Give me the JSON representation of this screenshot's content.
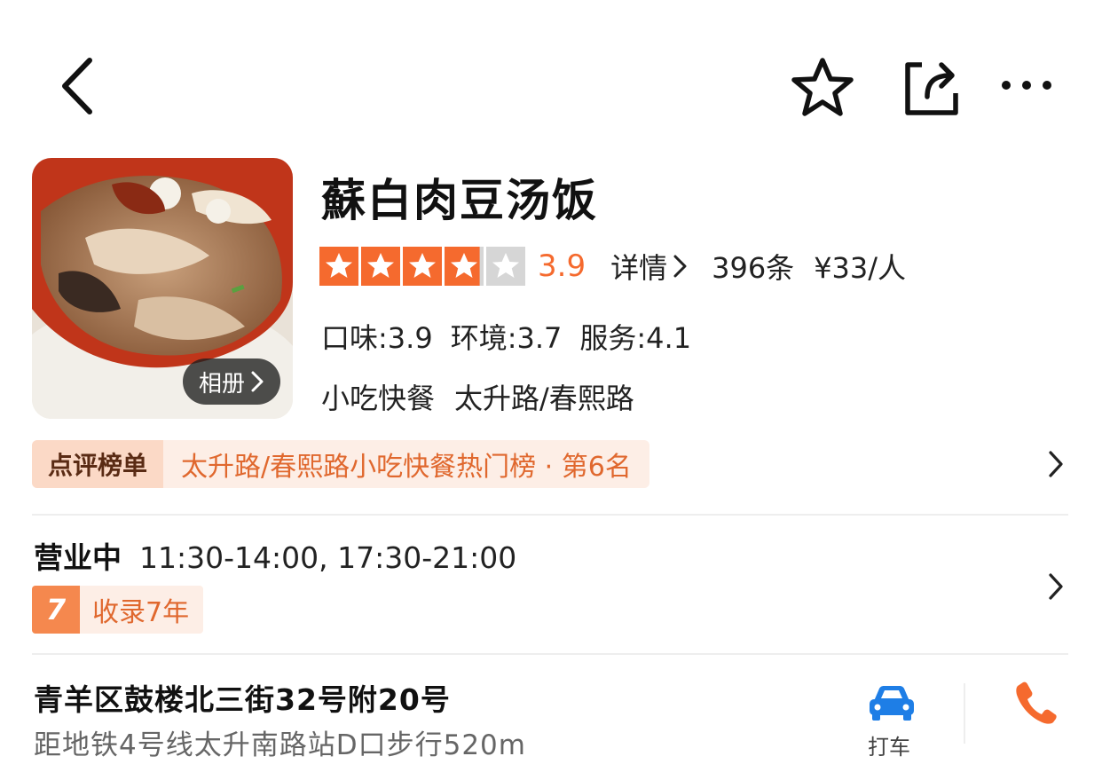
{
  "nav": {
    "back_icon": "chevron-left-icon",
    "favorite_icon": "star-outline-icon",
    "share_icon": "share-icon",
    "more_icon": "more-dots-icon"
  },
  "shop": {
    "name": "蘇白肉豆汤饭",
    "album_label": "相册",
    "rating": 3.9,
    "rating_text": "3.9",
    "detail_label": "详情",
    "review_count": "396条",
    "price": "¥33/人",
    "subscores": {
      "taste": "口味:3.9",
      "environment": "环境:3.7",
      "service": "服务:4.1"
    },
    "category": "小吃快餐",
    "area": "太升路/春熙路"
  },
  "ranking": {
    "badge": "点评榜单",
    "text": "太升路/春熙路小吃快餐热门榜 · 第6名"
  },
  "hours": {
    "status": "营业中",
    "times": "11:30-14:00, 17:30-21:00"
  },
  "listed": {
    "years_number": "7",
    "text": "收录7年"
  },
  "address": {
    "street": "青羊区鼓楼北三街32号附20号",
    "metro": "距地铁4号线太升南路站D口步行520m",
    "taxi_label": "打车"
  },
  "colors": {
    "accent": "#f56a2e",
    "star_on": "#f56a2e",
    "star_off": "#d6d6d6",
    "taxi_blue": "#1e7ee6"
  }
}
